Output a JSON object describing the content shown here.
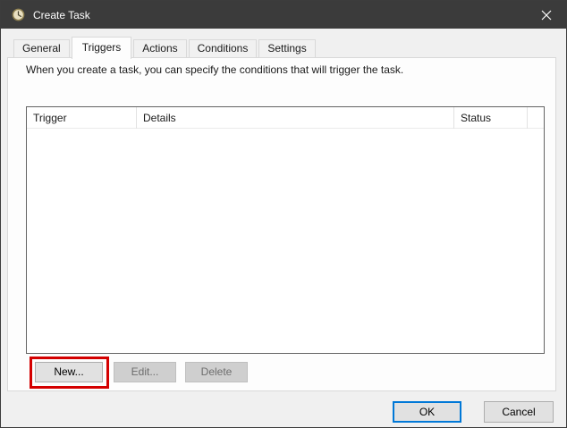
{
  "window": {
    "title": "Create Task"
  },
  "tabs": [
    {
      "label": "General",
      "selected": false
    },
    {
      "label": "Triggers",
      "selected": true
    },
    {
      "label": "Actions",
      "selected": false
    },
    {
      "label": "Conditions",
      "selected": false
    },
    {
      "label": "Settings",
      "selected": false
    }
  ],
  "content": {
    "description": "When you create a task, you can specify the conditions that will trigger the task.",
    "trigger_list": {
      "columns": [
        "Trigger",
        "Details",
        "Status"
      ],
      "rows": []
    },
    "buttons": {
      "new": "New...",
      "edit": "Edit...",
      "delete": "Delete"
    }
  },
  "footer": {
    "ok": "OK",
    "cancel": "Cancel"
  },
  "colors": {
    "titlebar": "#3b3b3b",
    "focus_accent": "#0078d7",
    "annotation_red": "#d40000",
    "dialog_background": "#f0f0f0"
  },
  "icons": {
    "app": "clock-icon",
    "close": "close-icon"
  }
}
